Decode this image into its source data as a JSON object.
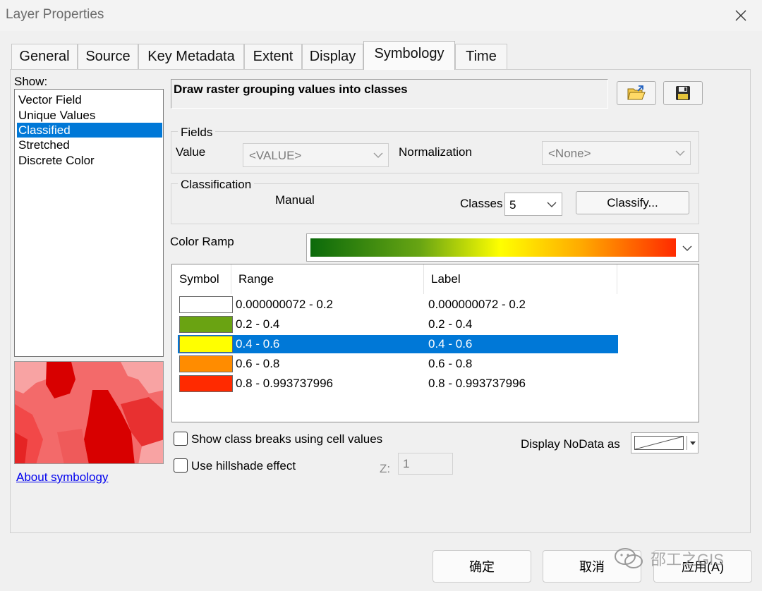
{
  "window": {
    "title": "Layer Properties"
  },
  "tabs": [
    {
      "label": "General"
    },
    {
      "label": "Source"
    },
    {
      "label": "Key Metadata"
    },
    {
      "label": "Extent"
    },
    {
      "label": "Display"
    },
    {
      "label": "Symbology",
      "active": true
    },
    {
      "label": "Time"
    }
  ],
  "show": {
    "label": "Show:",
    "items": [
      "Vector Field",
      "Unique Values",
      "Classified",
      "Stretched",
      "Discrete Color"
    ],
    "selected": "Classified"
  },
  "about_link": "About symbology",
  "description": "Draw raster grouping values into classes",
  "fields": {
    "title": "Fields",
    "value_label": "Value",
    "value_combo": "<VALUE>",
    "normalization_label": "Normalization",
    "normalization_combo": "<None>"
  },
  "classification": {
    "title": "Classification",
    "method": "Manual",
    "classes_label": "Classes",
    "classes_value": "5",
    "classify_button": "Classify..."
  },
  "color_ramp": {
    "label": "Color Ramp",
    "stops": [
      "#0b6a0b",
      "#68a513",
      "#ffff00",
      "#ffaa00",
      "#ff2a00"
    ]
  },
  "table": {
    "headers": {
      "symbol": "Symbol",
      "range": "Range",
      "label": "Label"
    },
    "rows": [
      {
        "color": "#ffffff",
        "range": "0.000000072 - 0.2",
        "label": "0.000000072 - 0.2"
      },
      {
        "color": "#6aa312",
        "range": "0.2 - 0.4",
        "label": "0.2 - 0.4"
      },
      {
        "color": "#ffff00",
        "range": "0.4 - 0.6",
        "label": "0.4 - 0.6",
        "selected": true
      },
      {
        "color": "#ff8c00",
        "range": "0.6 - 0.8",
        "label": "0.6 - 0.8"
      },
      {
        "color": "#ff2a00",
        "range": "0.8 - 0.993737996",
        "label": "0.8 - 0.993737996"
      }
    ]
  },
  "options": {
    "class_breaks": "Show class breaks using cell values",
    "hillshade": "Use hillshade effect",
    "z_label": "Z:",
    "z_value": "1",
    "nodata_label": "Display NoData as"
  },
  "footer": {
    "ok": "确定",
    "cancel": "取消",
    "apply": "应用(A)"
  },
  "watermark": "邵工之GIS"
}
